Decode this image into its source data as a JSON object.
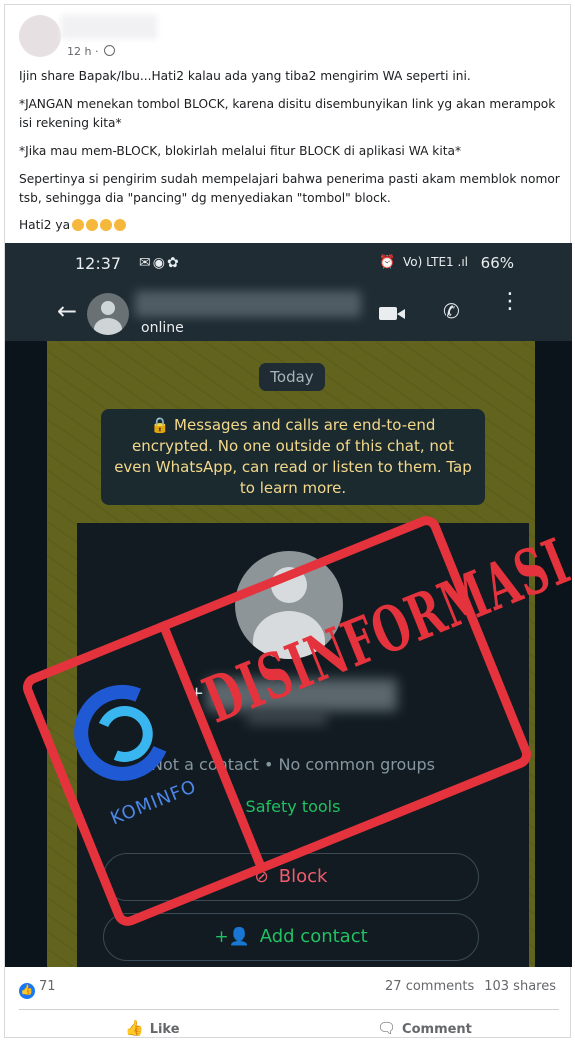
{
  "post": {
    "time": "12 h",
    "captions": [
      "Ijin share Bapak/Ibu...Hati2 kalau ada yang tiba2 mengirim WA seperti ini.",
      "*JANGAN menekan tombol BLOCK, karena disitu disembunyikan link yg akan merampok isi rekening kita*",
      "*Jika mau mem-BLOCK, blokirlah melalui fitur BLOCK di aplikasi WA kita*",
      "Sepertinya si pengirim sudah mempelajari bahwa penerima pasti akam memblok nomor tsb, sehingga dia \"pancing\" dg menyediakan \"tombol\" block.",
      "Hati2 ya"
    ],
    "reactions_count": "71",
    "comments": "27 comments",
    "shares": "103 shares",
    "like_label": "Like",
    "comment_label": "Comment"
  },
  "screenshot": {
    "status_time": "12:37",
    "status_net": "Vo) LTE1 .ıl",
    "battery": "66%",
    "contact_status": "online",
    "today": "Today",
    "encryption_notice": "Messages and calls are end-to-end encrypted. No one outside of this chat, not even WhatsApp, can read or listen to them. Tap to learn more.",
    "phone_prefix": "+",
    "not_contact": "Not a contact • No common groups",
    "safety_tools": "Safety tools",
    "block_label": "Block",
    "add_contact_label": "Add contact"
  },
  "stamp": {
    "text": "DISINFORMASI",
    "logo_text": "KOMINFO",
    "color": "#e5333d"
  },
  "colors": {
    "facebook_blue": "#1877f2",
    "whatsapp_green": "#21c063",
    "block_red": "#f15c6d"
  },
  "icons": [
    "globe-icon",
    "back-arrow-icon",
    "video-call-icon",
    "phone-icon",
    "more-options-icon",
    "lock-icon",
    "block-icon",
    "add-contact-icon",
    "like-icon",
    "comment-icon"
  ]
}
